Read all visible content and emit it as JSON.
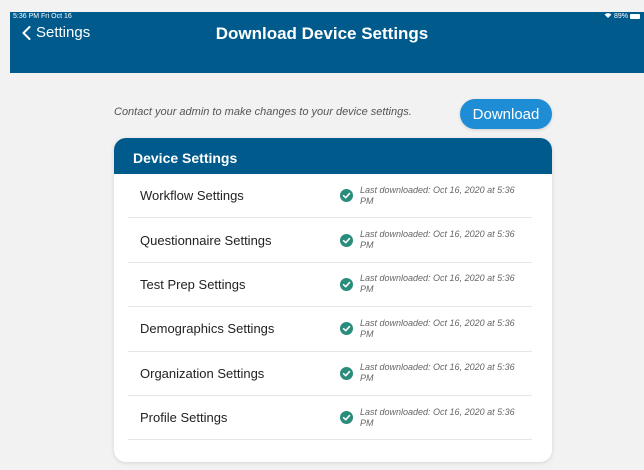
{
  "status_bar": {
    "time": "5:36 PM  Fri Oct 16",
    "battery": "89%"
  },
  "header": {
    "back_label": "Settings",
    "title": "Download Device Settings"
  },
  "contact_text": "Contact your admin to make changes to your device settings.",
  "download_label": "Download",
  "colors": {
    "header": "#005a8c",
    "accent": "#1f8dd6",
    "check": "#2a8c7a"
  },
  "card": {
    "title": "Device Settings",
    "rows": [
      {
        "label": "Workflow Settings",
        "status": "Last downloaded: Oct 16, 2020 at 5:36 PM"
      },
      {
        "label": "Questionnaire Settings",
        "status": "Last downloaded: Oct 16, 2020 at 5:36 PM"
      },
      {
        "label": "Test Prep Settings",
        "status": "Last downloaded: Oct 16, 2020 at 5:36 PM"
      },
      {
        "label": "Demographics Settings",
        "status": "Last downloaded: Oct 16, 2020 at 5:36 PM"
      },
      {
        "label": "Organization Settings",
        "status": "Last downloaded: Oct 16, 2020 at 5:36 PM"
      },
      {
        "label": "Profile Settings",
        "status": "Last downloaded: Oct 16, 2020 at 5:36 PM"
      }
    ]
  }
}
